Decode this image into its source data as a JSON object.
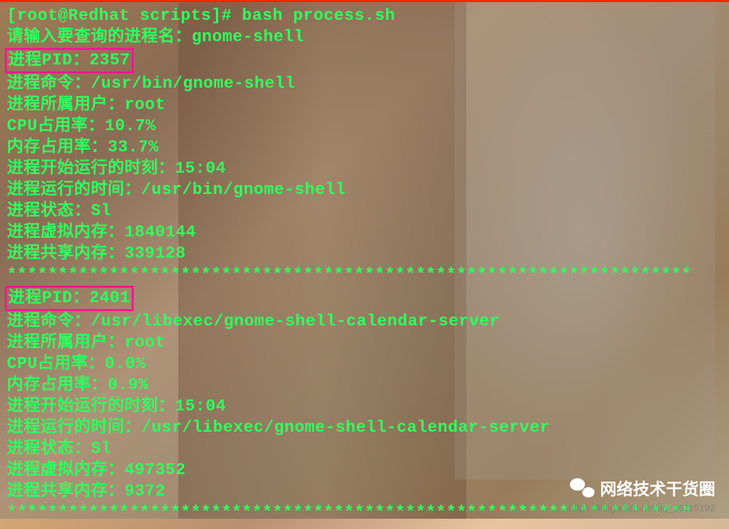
{
  "terminal": {
    "prompt": "[root@Redhat scripts]# ",
    "command": "bash process.sh",
    "input_prompt": "请输入要查询的进程名：",
    "input_value": "gnome-shell",
    "separator": "*******************************************************************",
    "processes": [
      {
        "pid_label": "进程PID：2357",
        "cmd": "进程命令：/usr/bin/gnome-shell",
        "user": "进程所属用户：root",
        "cpu": "CPU占用率：10.7%",
        "mem": "内存占用率：33.7%",
        "start": "进程开始运行的时刻：15:04",
        "runtime": "进程运行的时间：/usr/bin/gnome-shell",
        "stat": "进程状态：Sl",
        "vmem": "进程虚拟内存：1840144",
        "shmem": "进程共享内存：339128"
      },
      {
        "pid_label": "进程PID：2401",
        "cmd": "进程命令：/usr/libexec/gnome-shell-calendar-server",
        "user": "进程所属用户：root",
        "cpu": "CPU占用率：0.0%",
        "mem": "内存占用率：0.9%",
        "start": "进程开始运行的时刻：15:04",
        "runtime": "进程运行的时间：/usr/libexec/gnome-shell-calendar-server",
        "stat": "进程状态：Sl",
        "vmem": "进程虚拟内存：497352",
        "shmem": "进程共享内存：9372"
      }
    ]
  },
  "watermark": {
    "url": "https://blog.csdn.net/qq_36119192",
    "wechat_label": "网络技术干货圈"
  }
}
